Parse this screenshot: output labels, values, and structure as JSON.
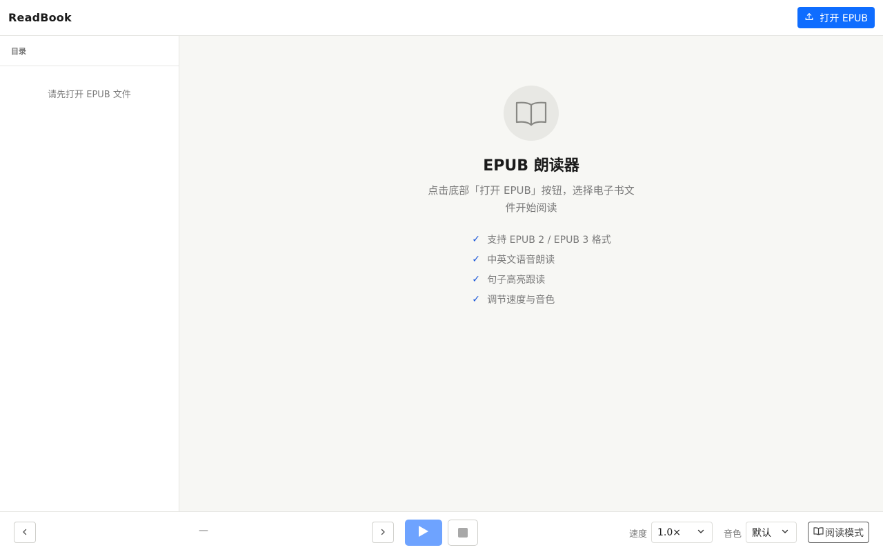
{
  "header": {
    "app_title": "ReadBook",
    "open_button_label": "打开 EPUB"
  },
  "sidebar": {
    "title": "目录",
    "empty_text": "请先打开 EPUB 文件"
  },
  "main": {
    "welcome_title": "EPUB 朗读器",
    "welcome_description": "点击底部「打开 EPUB」按钮，选择电子书文件开始阅读",
    "features": [
      "支持 EPUB 2 / EPUB 3 格式",
      "中英文语音朗读",
      "句子高亮跟读",
      "调节速度与音色"
    ]
  },
  "footer": {
    "chapter_indicator": "—",
    "speed_label": "速度",
    "speed_value": "1.0×",
    "voice_label": "音色",
    "voice_value": "默认",
    "reading_mode_label": "阅读模式"
  },
  "colors": {
    "accent": "#0f6dff",
    "play_button": "#6ea3ff",
    "check": "#1a56d9",
    "main_background": "#f7f7f4"
  },
  "icons": {
    "open": "upload-icon",
    "book": "open-book-icon",
    "check": "check-icon",
    "prev": "chevron-left-icon",
    "next": "chevron-right-icon",
    "play": "play-icon",
    "stop": "stop-icon",
    "dropdown": "chevron-down-icon",
    "reading_mode": "book-icon"
  }
}
